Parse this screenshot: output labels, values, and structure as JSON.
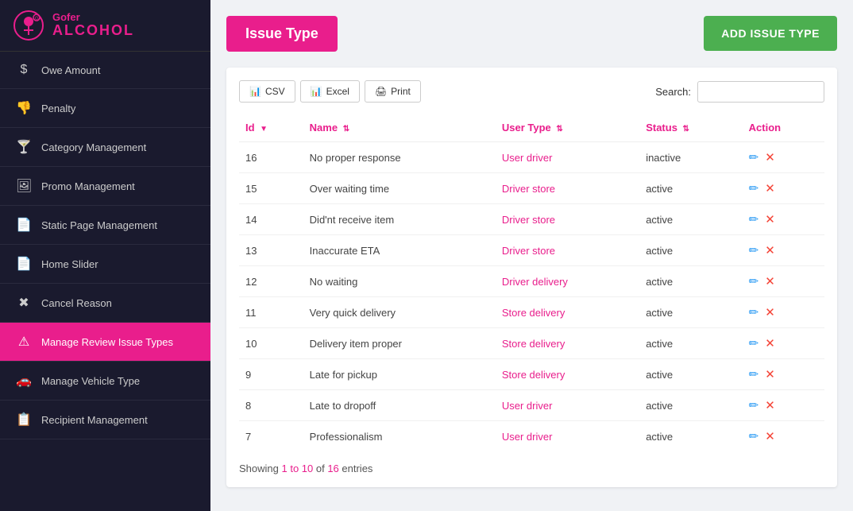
{
  "brand": {
    "gofer": "Gofer",
    "alcohol": "ALCOHOL"
  },
  "sidebar": {
    "items": [
      {
        "id": "owe-amount",
        "label": "Owe Amount",
        "icon": "$",
        "active": false
      },
      {
        "id": "penalty",
        "label": "Penalty",
        "icon": "👎",
        "active": false
      },
      {
        "id": "category-management",
        "label": "Category Management",
        "icon": "🍸",
        "active": false
      },
      {
        "id": "promo-management",
        "label": "Promo Management",
        "icon": "🖼",
        "active": false
      },
      {
        "id": "static-page-management",
        "label": "Static Page Management",
        "icon": "📄",
        "active": false
      },
      {
        "id": "home-slider",
        "label": "Home Slider",
        "icon": "📄",
        "active": false
      },
      {
        "id": "cancel-reason",
        "label": "Cancel Reason",
        "icon": "✖",
        "active": false
      },
      {
        "id": "manage-review-issue-types",
        "label": "Manage Review Issue Types",
        "icon": "⚠",
        "active": true
      },
      {
        "id": "manage-vehicle-type",
        "label": "Manage Vehicle Type",
        "icon": "🚗",
        "active": false
      },
      {
        "id": "recipient-management",
        "label": "Recipient Management",
        "icon": "📋",
        "active": false
      }
    ]
  },
  "page": {
    "title": "Issue Type",
    "add_button_label": "ADD ISSUE TYPE"
  },
  "toolbar": {
    "csv_label": "CSV",
    "excel_label": "Excel",
    "print_label": "Print",
    "search_label": "Search:"
  },
  "table": {
    "columns": [
      "Id",
      "Name",
      "User Type",
      "Status",
      "Action"
    ],
    "rows": [
      {
        "id": "16",
        "name": "No proper response",
        "user_type": "User driver",
        "status": "inactive"
      },
      {
        "id": "15",
        "name": "Over waiting time",
        "user_type": "Driver store",
        "status": "active"
      },
      {
        "id": "14",
        "name": "Did'nt receive item",
        "user_type": "Driver store",
        "status": "active"
      },
      {
        "id": "13",
        "name": "Inaccurate ETA",
        "user_type": "Driver store",
        "status": "active"
      },
      {
        "id": "12",
        "name": "No waiting",
        "user_type": "Driver delivery",
        "status": "active"
      },
      {
        "id": "11",
        "name": "Very quick delivery",
        "user_type": "Store delivery",
        "status": "active"
      },
      {
        "id": "10",
        "name": "Delivery item proper",
        "user_type": "Store delivery",
        "status": "active"
      },
      {
        "id": "9",
        "name": "Late for pickup",
        "user_type": "Store delivery",
        "status": "active"
      },
      {
        "id": "8",
        "name": "Late to dropoff",
        "user_type": "User driver",
        "status": "active"
      },
      {
        "id": "7",
        "name": "Professionalism",
        "user_type": "User driver",
        "status": "active"
      }
    ],
    "footer": {
      "prefix": "Showing ",
      "range": "1 to 10",
      "mid": " of ",
      "total": "16",
      "suffix": " entries"
    }
  }
}
